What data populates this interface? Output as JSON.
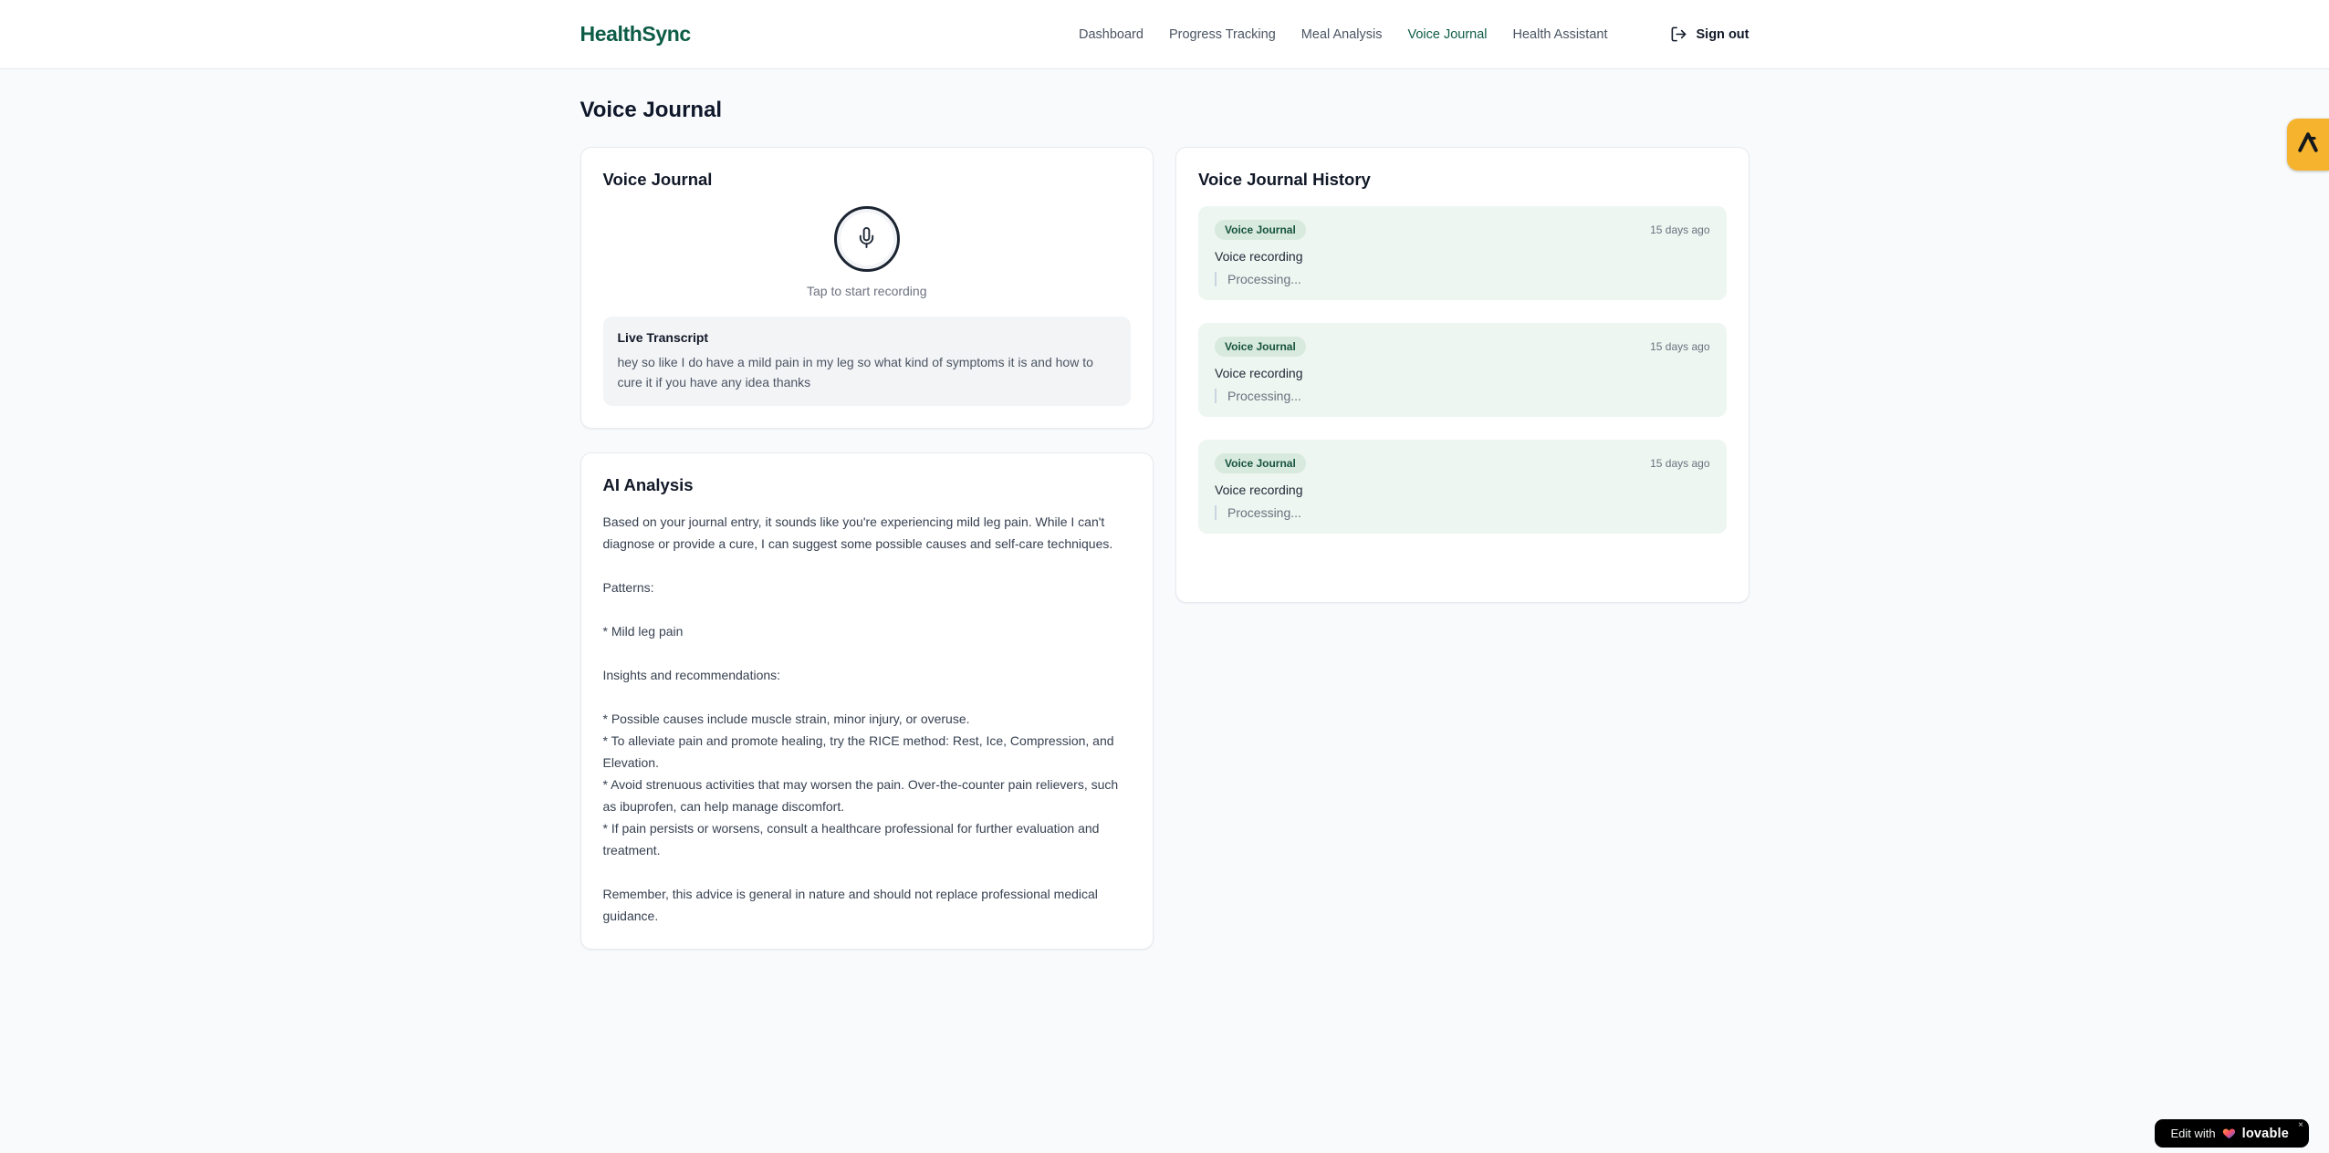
{
  "header": {
    "logo": "HealthSync",
    "nav": [
      {
        "label": "Dashboard",
        "active": false
      },
      {
        "label": "Progress Tracking",
        "active": false
      },
      {
        "label": "Meal Analysis",
        "active": false
      },
      {
        "label": "Voice Journal",
        "active": true
      },
      {
        "label": "Health Assistant",
        "active": false
      }
    ],
    "signout": {
      "icon": "log-out-icon",
      "label": "Sign out"
    }
  },
  "page": {
    "title": "Voice Journal"
  },
  "recorder": {
    "card_title": "Voice Journal",
    "mic_icon": "microphone-icon",
    "tap_label": "Tap to start recording",
    "transcript_title": "Live Transcript",
    "transcript_text": "hey so like I do have a mild pain in my leg so what kind of symptoms it is and how to cure it if you have any idea thanks"
  },
  "analysis": {
    "card_title": "AI Analysis",
    "body": "Based on your journal entry, it sounds like you're experiencing mild leg pain. While I can't diagnose or provide a cure, I can suggest some possible causes and self-care techniques.\n\nPatterns:\n\n* Mild leg pain\n\nInsights and recommendations:\n\n* Possible causes include muscle strain, minor injury, or overuse.\n* To alleviate pain and promote healing, try the RICE method: Rest, Ice, Compression, and Elevation.\n* Avoid strenuous activities that may worsen the pain. Over-the-counter pain relievers, such as ibuprofen, can help manage discomfort.\n* If pain persists or worsens, consult a healthcare professional for further evaluation and treatment.\n\nRemember, this advice is general in nature and should not replace professional medical guidance."
  },
  "history": {
    "card_title": "Voice Journal History",
    "entries": [
      {
        "badge": "Voice Journal",
        "time": "15 days ago",
        "title": "Voice recording",
        "status": "Processing..."
      },
      {
        "badge": "Voice Journal",
        "time": "15 days ago",
        "title": "Voice recording",
        "status": "Processing..."
      },
      {
        "badge": "Voice Journal",
        "time": "15 days ago",
        "title": "Voice recording",
        "status": "Processing..."
      }
    ]
  },
  "widgets": {
    "side_tab": {
      "icon": "feedback-widget-icon"
    },
    "edit_badge": {
      "prefix": "Edit with",
      "heart_icon": "heart-icon",
      "brand": "lovable",
      "close": "×"
    }
  },
  "colors": {
    "brand_green": "#0d5c46",
    "page_bg": "#f8fafc",
    "card_border": "#e7eaee",
    "entry_bg": "#edf6f0",
    "badge_bg": "#d8e9de",
    "badge_text": "#17543e",
    "muted_text": "#6b7280",
    "amber_tab": "#f5b32e",
    "badge_black": "#000000"
  }
}
